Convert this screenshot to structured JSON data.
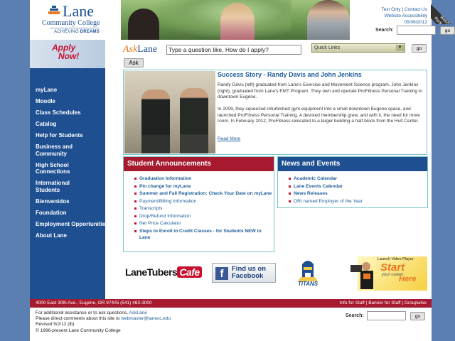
{
  "logo": {
    "name": "Lane",
    "subtitle": "Community College",
    "tagline_plain": "ACHIEVING ",
    "tagline_bold": "DREAMS"
  },
  "util": {
    "text_only": "Text Only",
    "separator": " | ",
    "contact_us": "Contact Us",
    "accessibility": "Website Accessibility",
    "date": "05/06/2012",
    "search_label": "Search:",
    "search_button": "go"
  },
  "apply": {
    "line1": "Apply",
    "line2": "Now!"
  },
  "ask": {
    "brand_a": "Ask",
    "brand_b": "Lane",
    "input_value": "Type a question like, How do I apply?",
    "ask_button": "Ask",
    "quick_links": "Quick Links",
    "go_button": "go"
  },
  "nav": {
    "items": [
      {
        "label": "myLane"
      },
      {
        "label": "Moodle"
      },
      {
        "label": "Class Schedules"
      },
      {
        "label": "Catalog"
      },
      {
        "label": "Help for Students"
      },
      {
        "label": "Business and Community"
      },
      {
        "label": "High School Connections"
      },
      {
        "label": "International Students"
      },
      {
        "label": "Bienvenidos"
      },
      {
        "label": "Foundation"
      },
      {
        "label": "Employment Opportunities"
      },
      {
        "label": "About Lane"
      }
    ]
  },
  "story": {
    "title": "Success Story - Randy Davis and John Jenkins",
    "p1": "Randy Davis (left) graduated from Lane's Exercise and Movement Science program. John Jenkins (right), graduated from Lane's EMT Program. They own and operate ProFitness Personal Training in downtown Eugene.",
    "p2": "In 2009, they squeezed refurbished gym equipment into a small downtown Eugene space, and launched ProFitness Personal Training. A devoted membership grew, and with it, the need for more room. In February 2012, ProFitness relocated to a larger building a half-block from the Hult Center.",
    "read_more": "Read More"
  },
  "announcements": {
    "title": "Student Announcements",
    "items": [
      {
        "label": "Graduation Information",
        "bold": true
      },
      {
        "label": "Pin change for myLane",
        "bold": true
      },
      {
        "label": "Summer and Fall Registration: Check Your Date on myLane",
        "bold": true
      },
      {
        "label": "Payment/Billing Information",
        "bold": false
      },
      {
        "label": "Transcripts",
        "bold": false
      },
      {
        "label": "Drop/Refund Information",
        "bold": false
      },
      {
        "label": "Net Price Calculator",
        "bold": false
      },
      {
        "label": "Steps to Enroll in Credit Classes - for Students NEW to Lane",
        "bold": true
      }
    ]
  },
  "news": {
    "title": "News and Events",
    "items": [
      {
        "label": "Academic Calendar",
        "bold": true
      },
      {
        "label": "Lane Events Calendar",
        "bold": true
      },
      {
        "label": "News Releases",
        "bold": true
      },
      {
        "label": "ORI named Employer of the Year",
        "bold": false
      }
    ]
  },
  "promo": {
    "tubers": "LaneTubers",
    "cafe": "Cafe",
    "fb_letter": "f",
    "fb_line1": "Find us on",
    "fb_line2": "Facebook",
    "titans": "TITANS",
    "video_launch": "Launch Video Player",
    "video_start": "Start",
    "video_career": "your career",
    "video_here": "Here"
  },
  "footer": {
    "address": "4000 East 30th Ave., Eugene, OR 97405 (541) 463-3000",
    "info_staff": "Info for Staff",
    "banner_staff": "Banner for Staff",
    "groupwise": "Groupwise",
    "sep": " | ",
    "assist": "For additional assistance or to ask questions, ",
    "asklane": "AskLane",
    "comments": "Please direct comments about this site to ",
    "email": "webmaster@lanecc.edu",
    "revised": "Revised 5/2/12 (lb)",
    "copyright": "© 1996-present Lane Community College",
    "search_label": "Search:",
    "search_button": "go"
  },
  "corner": {
    "line1": "WebS",
    "line2": "Redesign"
  },
  "colors": {
    "brand_blue": "#1d4f91",
    "brand_red": "#a6192e",
    "accent_orange": "#e87722",
    "frame_blue": "#5a7fb0"
  }
}
